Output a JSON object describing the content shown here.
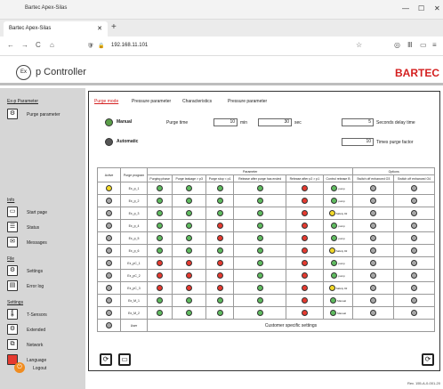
{
  "browser": {
    "window_title": "Bartec Apex-Silas",
    "tab_title": "Bartec Apex-Silas",
    "url": "192.168.11.101"
  },
  "app": {
    "logo_text": "Ex",
    "title": "p Controller",
    "brand": "BARTEC",
    "brand_color": "#d42020"
  },
  "sidebar": {
    "sections": [
      {
        "title": "Ex-p Parameter",
        "items": [
          {
            "label": "Purge parameter",
            "icon": "settings-sliders-icon"
          }
        ]
      },
      {
        "title": "Info",
        "items": [
          {
            "label": "Start page",
            "icon": "monitor-icon"
          },
          {
            "label": "Status",
            "icon": "document-icon"
          },
          {
            "label": "Messages",
            "icon": "message-icon"
          }
        ]
      },
      {
        "title": "File",
        "items": [
          {
            "label": "Settings",
            "icon": "gear-icon"
          },
          {
            "label": "Error log",
            "icon": "log-icon"
          }
        ]
      },
      {
        "title": "Settings",
        "items": [
          {
            "label": "T-Sensors",
            "icon": "thermometer-icon"
          },
          {
            "label": "Extended",
            "icon": "extended-icon"
          },
          {
            "label": "Network",
            "icon": "network-icon"
          },
          {
            "label": "Language",
            "icon": "flag-icon"
          }
        ]
      }
    ],
    "logout_label": "Logout"
  },
  "main": {
    "tabs": [
      "Purge mode",
      "Pressure parameter",
      "Characteristics",
      "Pressure parameter"
    ],
    "manual_label": "Manual",
    "automatic_label": "Automatic",
    "purge_time_label": "Purge time",
    "purge_time_min": "10",
    "purge_time_min_unit": "min",
    "purge_time_sec": "30",
    "purge_time_sec_unit": "sec",
    "delay_value": "5",
    "delay_label": "Seconds delay time",
    "factor_value": "10",
    "factor_label": "Times purge factor"
  },
  "table": {
    "col_active": "Active",
    "col_program": "Purge program",
    "group_parameter": "Parameter",
    "group_options": "Options",
    "sub_headers": [
      "Purging phase",
      "Purge leakage > p3",
      "Purge stop < p1",
      "Release after purge has ended",
      "Release after p2 > p1",
      "Control release B",
      "Switch off enhanced O3",
      "Switch off enhanced O4"
    ],
    "rows": [
      {
        "name": "Ex_p_1",
        "active": "yellow",
        "p": [
          "green",
          "green",
          "green",
          "green",
          "red",
          "green"
        ],
        "ctrl_text": "pump",
        "o": [
          "gray",
          "gray"
        ]
      },
      {
        "name": "Ex_p_2",
        "active": "gray",
        "p": [
          "green",
          "green",
          "green",
          "green",
          "red",
          "green"
        ],
        "ctrl_text": "pump",
        "o": [
          "gray",
          "gray"
        ]
      },
      {
        "name": "Ex_p_3",
        "active": "gray",
        "p": [
          "green",
          "green",
          "green",
          "green",
          "red",
          "yellow"
        ],
        "ctrl_text": "Safety 02",
        "o": [
          "gray",
          "gray"
        ]
      },
      {
        "name": "Ex_p_4",
        "active": "gray",
        "p": [
          "green",
          "green",
          "red",
          "green",
          "red",
          "green"
        ],
        "ctrl_text": "pump",
        "o": [
          "gray",
          "gray"
        ]
      },
      {
        "name": "Ex_p_5",
        "active": "gray",
        "p": [
          "green",
          "green",
          "red",
          "green",
          "red",
          "green"
        ],
        "ctrl_text": "pump",
        "o": [
          "gray",
          "gray"
        ]
      },
      {
        "name": "Ex_p_6",
        "active": "gray",
        "p": [
          "green",
          "green",
          "green",
          "green",
          "red",
          "yellow"
        ],
        "ctrl_text": "Safety 02",
        "o": [
          "gray",
          "gray"
        ]
      },
      {
        "name": "Ex_pC_1",
        "active": "gray",
        "p": [
          "red",
          "red",
          "red",
          "green",
          "red",
          "green"
        ],
        "ctrl_text": "pump",
        "o": [
          "gray",
          "gray"
        ]
      },
      {
        "name": "Ex_pC_2",
        "active": "gray",
        "p": [
          "red",
          "red",
          "red",
          "green",
          "red",
          "green"
        ],
        "ctrl_text": "pump",
        "o": [
          "gray",
          "gray"
        ]
      },
      {
        "name": "Ex_pC_3",
        "active": "gray",
        "p": [
          "red",
          "red",
          "red",
          "green",
          "red",
          "yellow"
        ],
        "ctrl_text": "Safety 02",
        "o": [
          "gray",
          "gray"
        ]
      },
      {
        "name": "Ex_M_1",
        "active": "gray",
        "p": [
          "green",
          "green",
          "green",
          "green",
          "red",
          "green"
        ],
        "ctrl_text": "Manual",
        "o": [
          "gray",
          "gray"
        ]
      },
      {
        "name": "Ex_M_2",
        "active": "gray",
        "p": [
          "green",
          "green",
          "green",
          "green",
          "red",
          "green"
        ],
        "ctrl_text": "Manual",
        "o": [
          "gray",
          "gray"
        ]
      }
    ],
    "user_row": {
      "name": "User",
      "label": "Customer specific settings"
    }
  },
  "footer": {
    "revision": "Rev. 155-A-0-001-20"
  }
}
